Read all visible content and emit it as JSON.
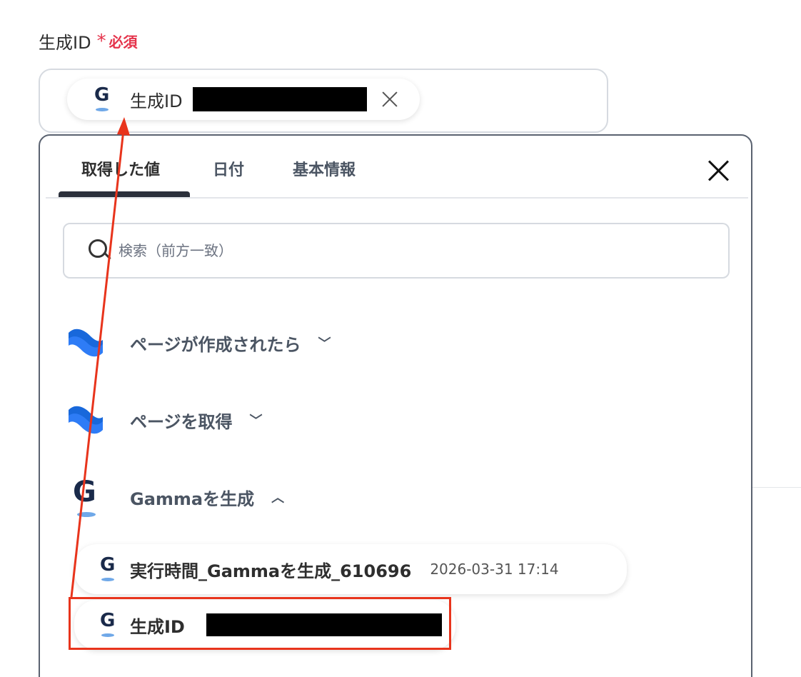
{
  "field": {
    "label": "生成ID",
    "asterisk": "*",
    "required": "必須"
  },
  "selected_chip": {
    "label": "生成ID",
    "icon": "gamma-icon"
  },
  "panel": {
    "tabs": [
      {
        "label": "取得した値",
        "active": true
      },
      {
        "label": "日付",
        "active": false
      },
      {
        "label": "基本情報",
        "active": false
      }
    ],
    "search_placeholder": "検索（前方一致）",
    "groups": [
      {
        "label": "ページが作成されたら",
        "icon": "confluence-icon",
        "state": "collapsed"
      },
      {
        "label": "ページを取得",
        "icon": "confluence-icon",
        "state": "collapsed"
      },
      {
        "label": "Gammaを生成",
        "icon": "gamma-icon",
        "state": "expanded"
      }
    ],
    "items": [
      {
        "label": "実行時間_Gammaを生成_610696",
        "value": "2026-03-31 17:14"
      },
      {
        "label": "生成ID"
      }
    ]
  },
  "colors": {
    "required": "#e5334b",
    "annotation": "#e8341c",
    "confluence_blue": "#1868db",
    "gamma_navy": "#1a2a4a"
  }
}
